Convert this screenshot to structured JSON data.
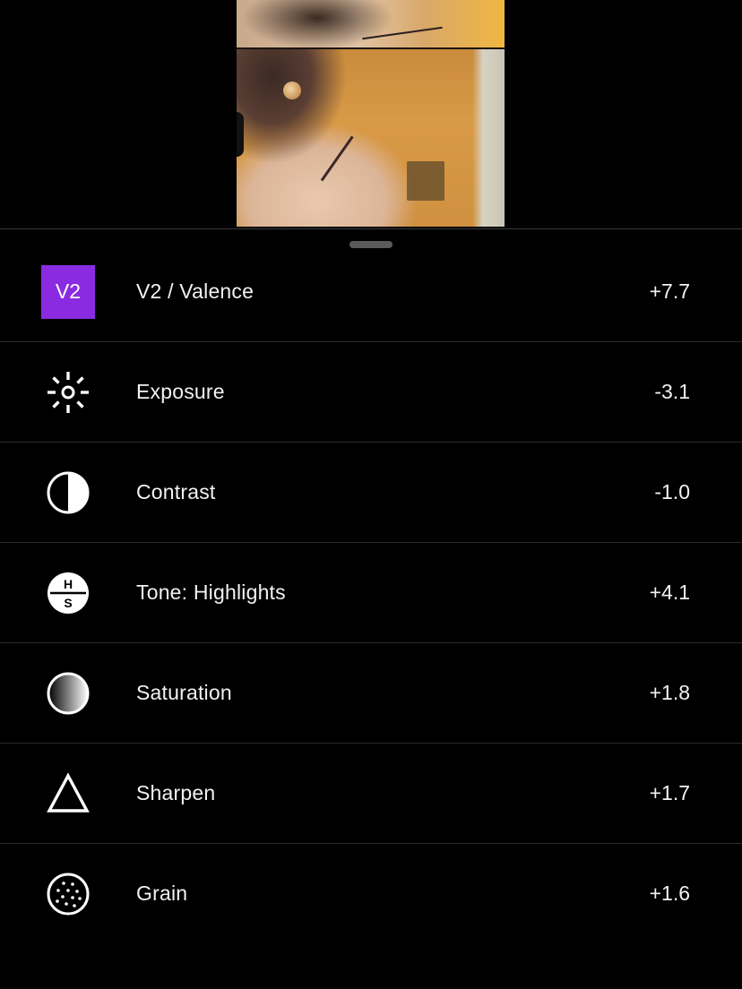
{
  "colors": {
    "background": "#000000",
    "accent_v2": "#8a2be2",
    "text": "#f2f2f2",
    "divider": "#2c2c2c"
  },
  "preview": {
    "description_icon": "photo-preview"
  },
  "adjustments": [
    {
      "icon": "v2-badge",
      "badge_text": "V2",
      "label": "V2 / Valence",
      "value": "+7.7"
    },
    {
      "icon": "exposure-sun-icon",
      "label": "Exposure",
      "value": "-3.1"
    },
    {
      "icon": "contrast-half-circle-icon",
      "label": "Contrast",
      "value": "-1.0"
    },
    {
      "icon": "tone-hs-icon",
      "icon_text_top": "H",
      "icon_text_bottom": "S",
      "label": "Tone: Highlights",
      "value": "+4.1"
    },
    {
      "icon": "saturation-gradient-icon",
      "label": "Saturation",
      "value": "+1.8"
    },
    {
      "icon": "sharpen-triangle-icon",
      "label": "Sharpen",
      "value": "+1.7"
    },
    {
      "icon": "grain-dots-icon",
      "label": "Grain",
      "value": "+1.6"
    }
  ]
}
